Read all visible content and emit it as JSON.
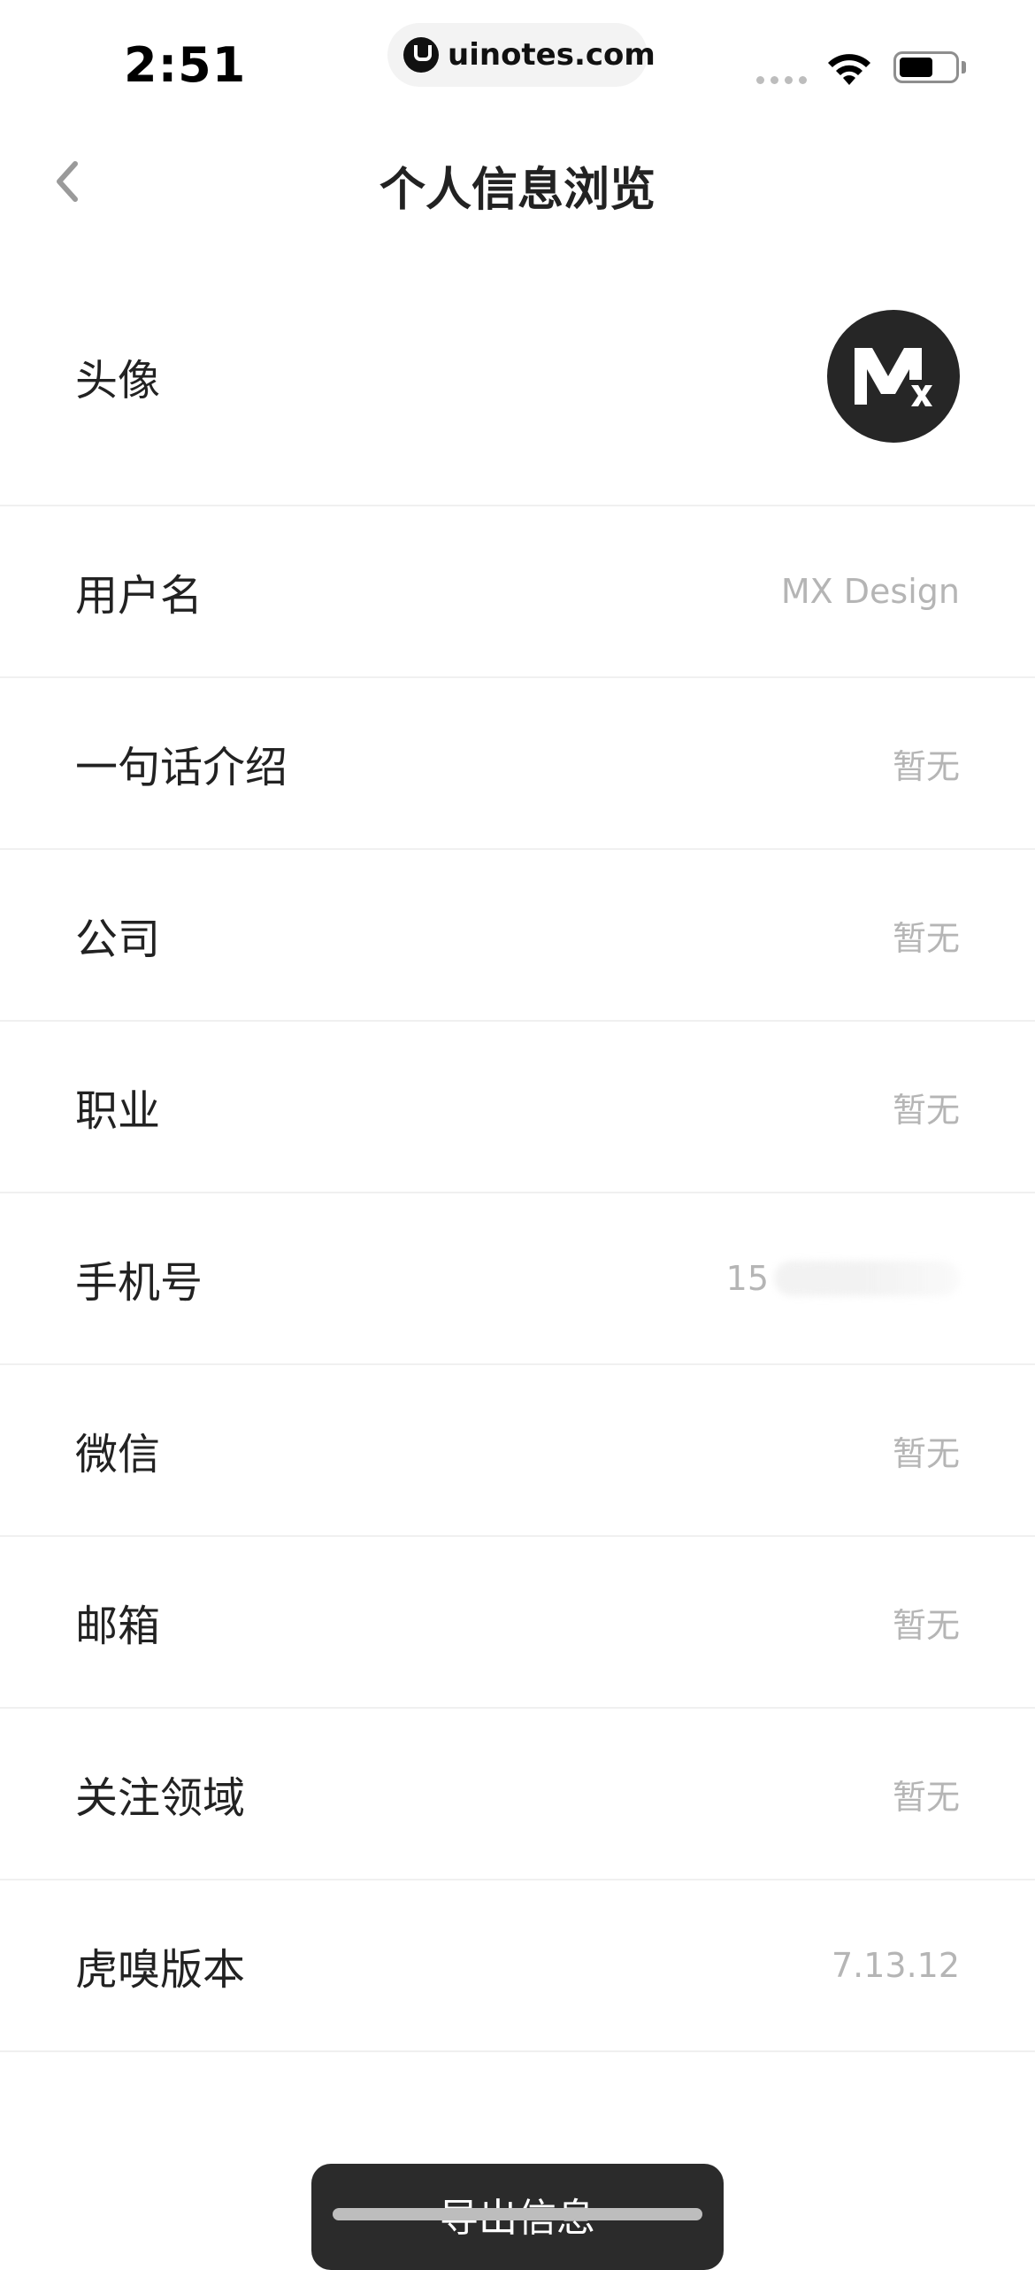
{
  "status_bar": {
    "time": "2:51",
    "watermark": "uinotes.com",
    "battery_level": 0.6
  },
  "nav": {
    "title": "个人信息浏览"
  },
  "rows": [
    {
      "label": "头像",
      "value": ""
    },
    {
      "label": "用户名",
      "value": "MX Design"
    },
    {
      "label": "一句话介绍",
      "value": "暂无"
    },
    {
      "label": "公司",
      "value": "暂无"
    },
    {
      "label": "职业",
      "value": "暂无"
    },
    {
      "label": "手机号",
      "value": "15"
    },
    {
      "label": "微信",
      "value": "暂无"
    },
    {
      "label": "邮箱",
      "value": "暂无"
    },
    {
      "label": "关注领域",
      "value": "暂无"
    },
    {
      "label": "虎嗅版本",
      "value": "7.13.12"
    }
  ],
  "export_button": {
    "label": "导出信息"
  },
  "colors": {
    "text_primary": "#222222",
    "text_secondary": "#b5b5b5",
    "divider": "#f0f0f0",
    "button_bg": "#2b2b2b",
    "avatar_bg": "#262626"
  }
}
